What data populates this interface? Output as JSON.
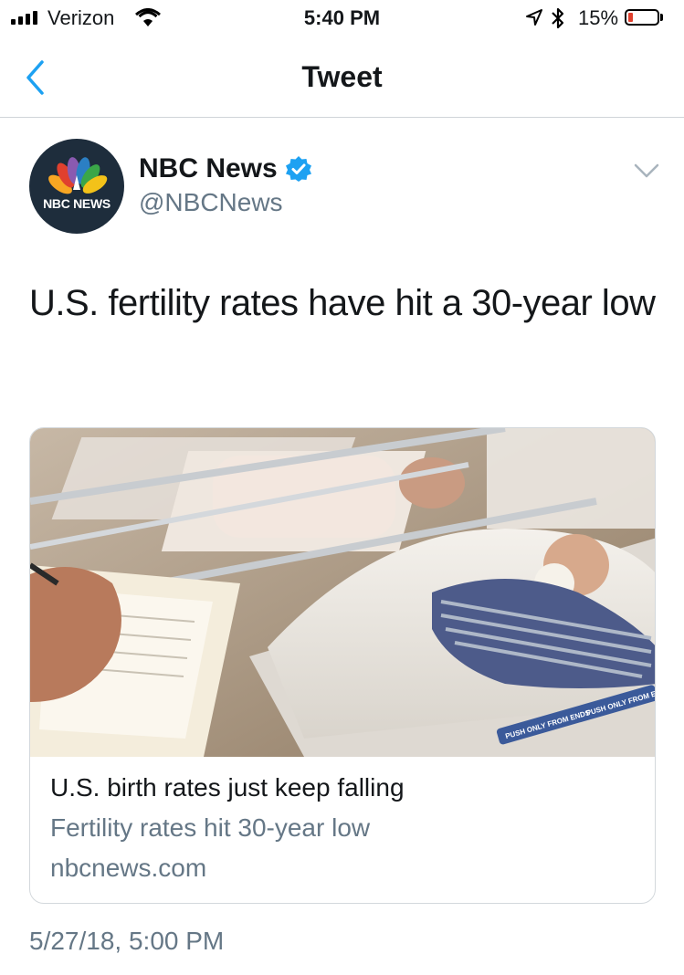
{
  "status_bar": {
    "carrier": "Verizon",
    "time": "5:40 PM",
    "battery_percent": "15%",
    "battery_level": 0.15,
    "battery_color": "#e0402e"
  },
  "nav": {
    "title": "Tweet",
    "back_icon": "chevron-left-icon",
    "accent_color": "#1da1f2"
  },
  "tweet": {
    "author": {
      "display_name": "NBC News",
      "handle": "@NBCNews",
      "verified": true,
      "avatar_text": "NBC NEWS"
    },
    "text": "U.S. fertility rates have hit a 30-year low",
    "card": {
      "title": "U.S. birth rates just keep falling",
      "description": "Fertility rates hit 30-year low",
      "domain": "nbcnews.com",
      "image_labels": [
        "PUSH ONLY FROM ENDS",
        "PUSH ONLY FROM ENDS"
      ]
    },
    "timestamp": "5/27/18, 5:00 PM"
  }
}
